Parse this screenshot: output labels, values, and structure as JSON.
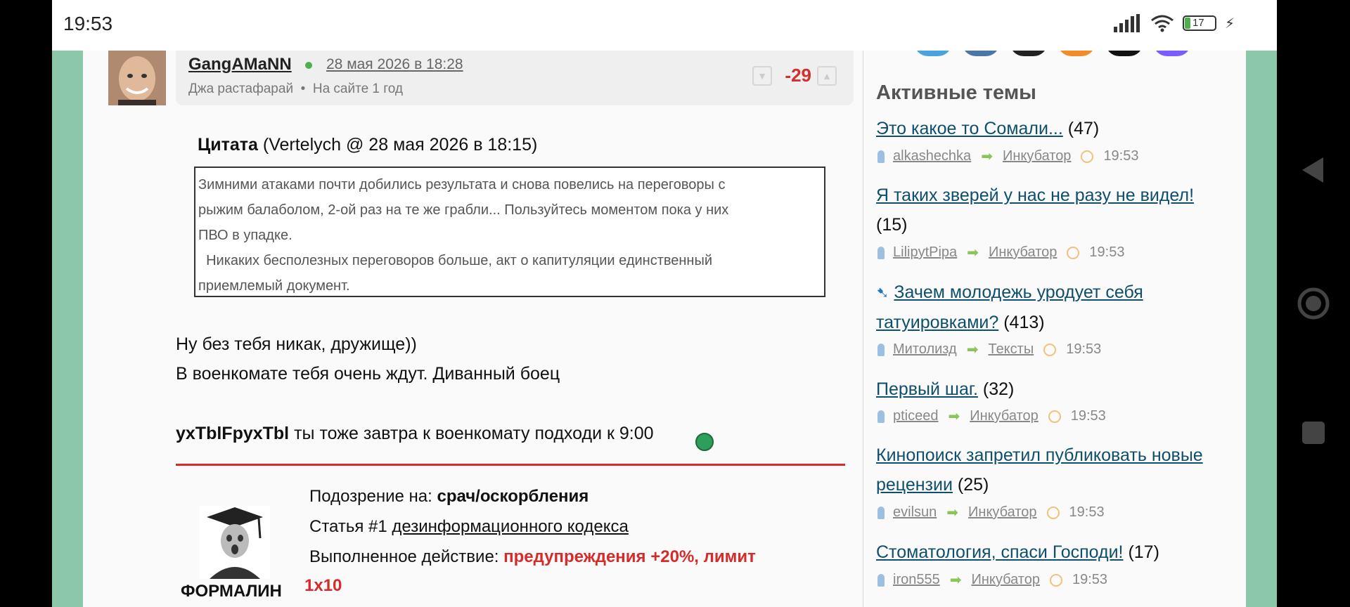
{
  "status_bar": {
    "time": "19:53",
    "battery": "17"
  },
  "post": {
    "username": "GangAMaNN",
    "date": "28 мая 2026 в 18:28",
    "status": "Джа растафарай",
    "on_site": "На сайте 1 год",
    "rating": "-29"
  },
  "quote": {
    "label": "Цитата",
    "meta": " (Vertelych @ 28 мая 2026 в 18:15)",
    "lines": [
      "Зимними атаками почти добились  результата и снова повелись на переговоры с",
      "рыжим балаболом, 2-ой раз на те же грабли...  Пользуйтесь моментом пока у них",
      "ПВО в упадке.",
      "  Никаких бесполезных переговоров больше, акт о капитуляции единственный",
      "приемлемый документ."
    ]
  },
  "body": {
    "line1": "Ну без тебя никак, дружище))",
    "line2": "В военкомате тебя очень ждут. Диванный боец",
    "mention": "yxTblFpyxTbl",
    "line3": " ты тоже завтра к военкомату подходи к 9:00"
  },
  "moderation": {
    "moderator": "ФОРМАЛИН",
    "suspicion_label": "Подозрение на: ",
    "suspicion_value": "срач/оскорбления",
    "article_label": "Статья #1 ",
    "article_link": "дезинформационного кодекса",
    "action_label": "Выполненное действие: ",
    "action_value": "предупреждения +20%, лимит",
    "action_value2": "1x10"
  },
  "sidebar": {
    "title": "Активные темы",
    "topics": [
      {
        "title": "Это какое то Сомали...",
        "count": "(47)",
        "user": "alkashechka",
        "section": "Инкубатор",
        "time": "19:53"
      },
      {
        "title": "Я таких зверей у нас не разу не видел!",
        "count": "(15)",
        "user": "LilipytPipa",
        "section": "Инкубатор",
        "time": "19:53"
      },
      {
        "title": "Зачем молодежь уродует себя татуировками?",
        "count": "(413)",
        "user": "Митолизд",
        "section": "Тексты",
        "time": "19:53"
      },
      {
        "title": "Первый шаг.",
        "count": "(32)",
        "user": "pticeed",
        "section": "Инкубатор",
        "time": "19:53"
      },
      {
        "title": "Кинопоиск запретил публиковать новые рецензии",
        "count": "(25)",
        "user": "evilsun",
        "section": "Инкубатор",
        "time": "19:53"
      },
      {
        "title": "Стоматология, спаси Господи!",
        "count": "(17)",
        "user": "iron555",
        "section": "Инкубатор",
        "time": "19:53"
      }
    ]
  },
  "colors": {
    "accent_red": "#d62b2b",
    "link": "#0f4f6e",
    "page_green": "#8bc7a8"
  }
}
